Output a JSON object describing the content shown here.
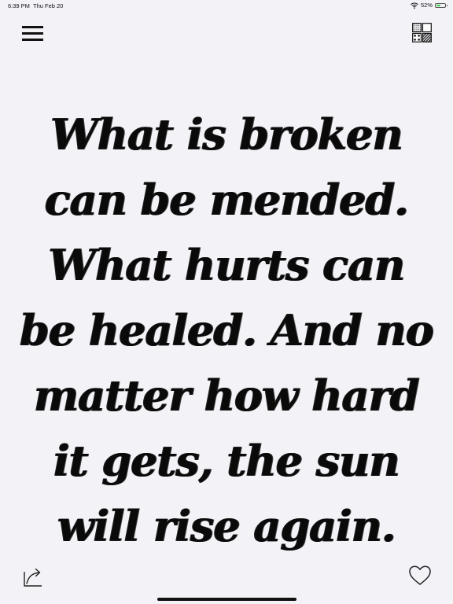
{
  "status_bar": {
    "time": "6:39 PM",
    "date": "Thu Feb 20",
    "battery_percent": "52%",
    "battery_level": 0.52,
    "icons": {
      "wifi": "wifi-icon",
      "battery": "battery-icon"
    }
  },
  "toolbar": {
    "menu_icon": "hamburger-menu-icon",
    "themes_icon": "themes-grid-icon"
  },
  "quote": {
    "text": "What is broken can be mended. What hurts can be healed. And no matter how hard it gets, the sun will rise again."
  },
  "bottom_bar": {
    "share_icon": "share-icon",
    "favorite_icon": "heart-icon"
  },
  "colors": {
    "background": "#f2f2f7",
    "text": "#000000",
    "battery_fill": "#2ecc40"
  }
}
